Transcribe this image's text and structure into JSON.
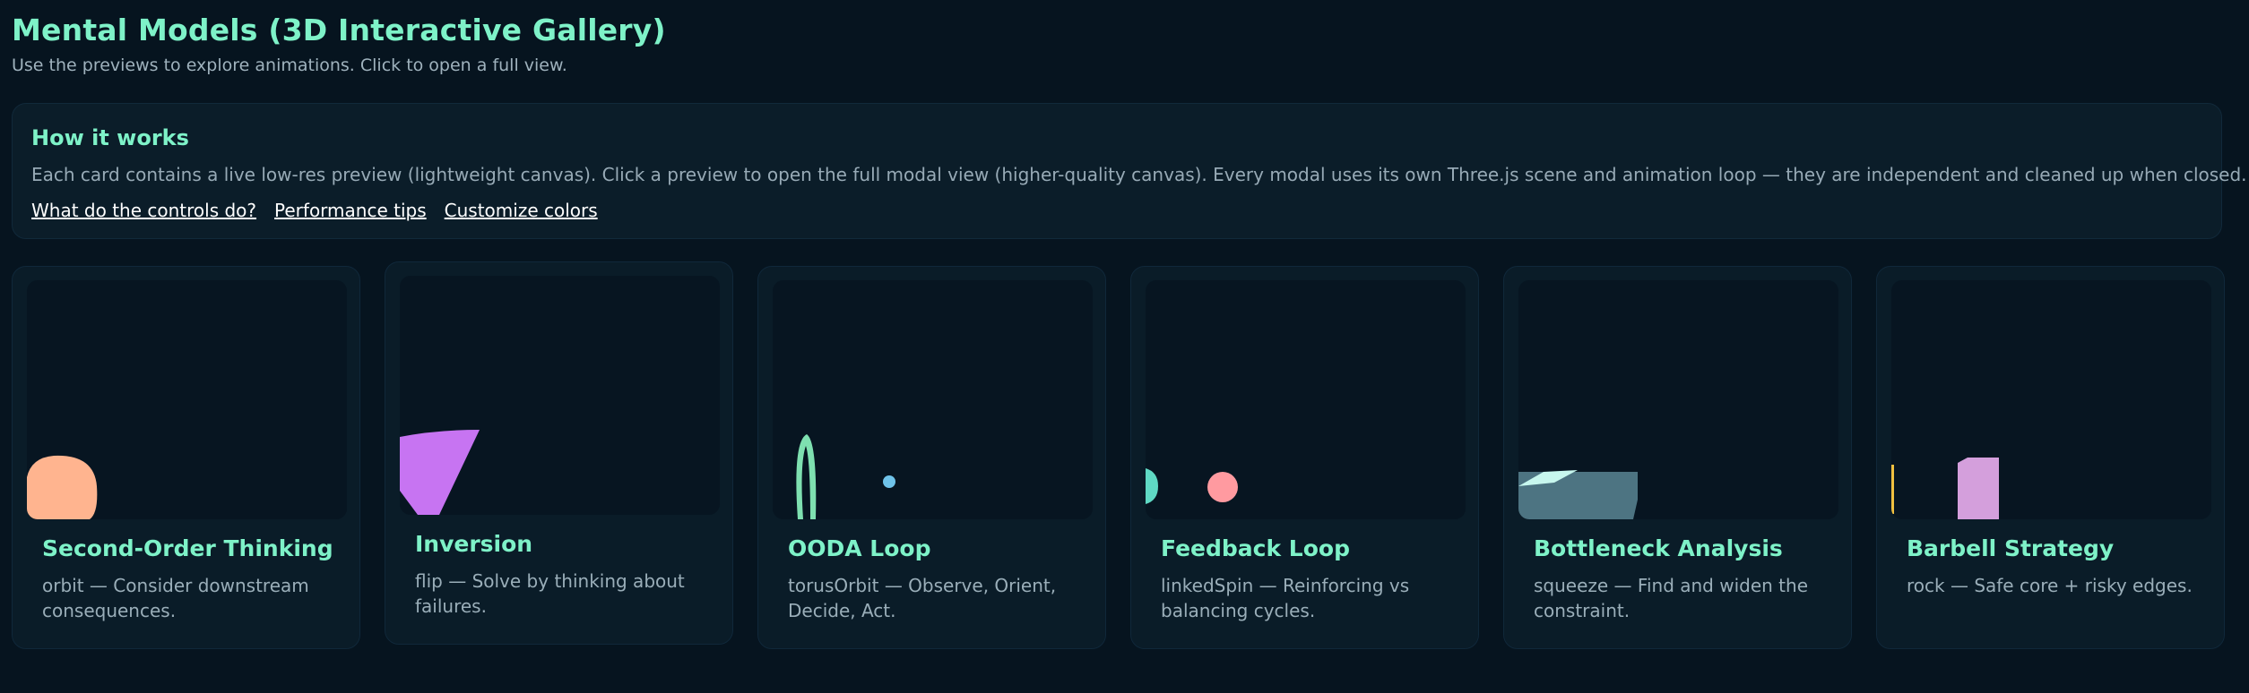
{
  "page": {
    "title": "Mental Models (3D Interactive Gallery)",
    "subtitle": "Use the previews to explore animations. Click to open a full view."
  },
  "info": {
    "heading": "How it works",
    "text": "Each card contains a live low-res preview (lightweight canvas). Click a preview to open the full modal view (higher-quality canvas). Every modal uses its own Three.js scene and animation loop — they are independent and cleaned up when closed.",
    "links": [
      "What do the controls do?",
      "Performance tips",
      "Customize colors"
    ]
  },
  "cards": [
    {
      "title": "Second-Order Thinking",
      "desc": "orbit — Consider downstream consequences.",
      "accent": "#ffb48f"
    },
    {
      "title": "Inversion",
      "desc": "flip — Solve by thinking about failures.",
      "accent": "#c774f2"
    },
    {
      "title": "OODA Loop",
      "desc": "torusOrbit — Observe, Orient, Decide, Act.",
      "accent": "#7ee0b0"
    },
    {
      "title": "Feedback Loop",
      "desc": "linkedSpin — Reinforcing vs balancing cycles.",
      "accent": "#ff9aa0"
    },
    {
      "title": "Bottleneck Analysis",
      "desc": "squeeze — Find and widen the constraint.",
      "accent": "#4d7482"
    },
    {
      "title": "Barbell Strategy",
      "desc": "rock — Safe core + risky edges.",
      "accent": "#d49fdc"
    }
  ],
  "colors": {
    "background": "#06141f",
    "accent_text": "#7ef2c8",
    "panel": "#0b1d29",
    "preview": "#071521"
  }
}
